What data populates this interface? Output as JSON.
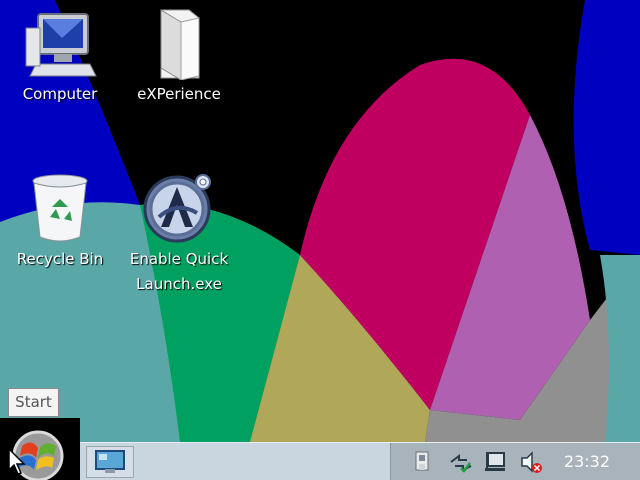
{
  "desktop": {
    "icons": [
      {
        "label": "Computer",
        "icon": "computer-icon"
      },
      {
        "label": "eXPerience",
        "icon": "folder-icon"
      },
      {
        "label": "Recycle Bin",
        "icon": "recycle-bin-icon"
      },
      {
        "label": "Enable Quick Launch.exe",
        "icon": "app-logo-icon"
      }
    ],
    "wallpaper_colors": [
      "#0000c0",
      "#000000",
      "#008080",
      "#5aa7a7",
      "#00a060",
      "#b0a858",
      "#c00060",
      "#b060b0",
      "#909090"
    ]
  },
  "tooltip": {
    "text": "Start"
  },
  "taskbar": {
    "start_icon": "start-orb-icon",
    "quick_launch_icon": "show-desktop-icon",
    "tray_icons": [
      "usb-icon",
      "network-disconnected-icon",
      "volume-muted-icon"
    ],
    "clock": "23:32"
  }
}
